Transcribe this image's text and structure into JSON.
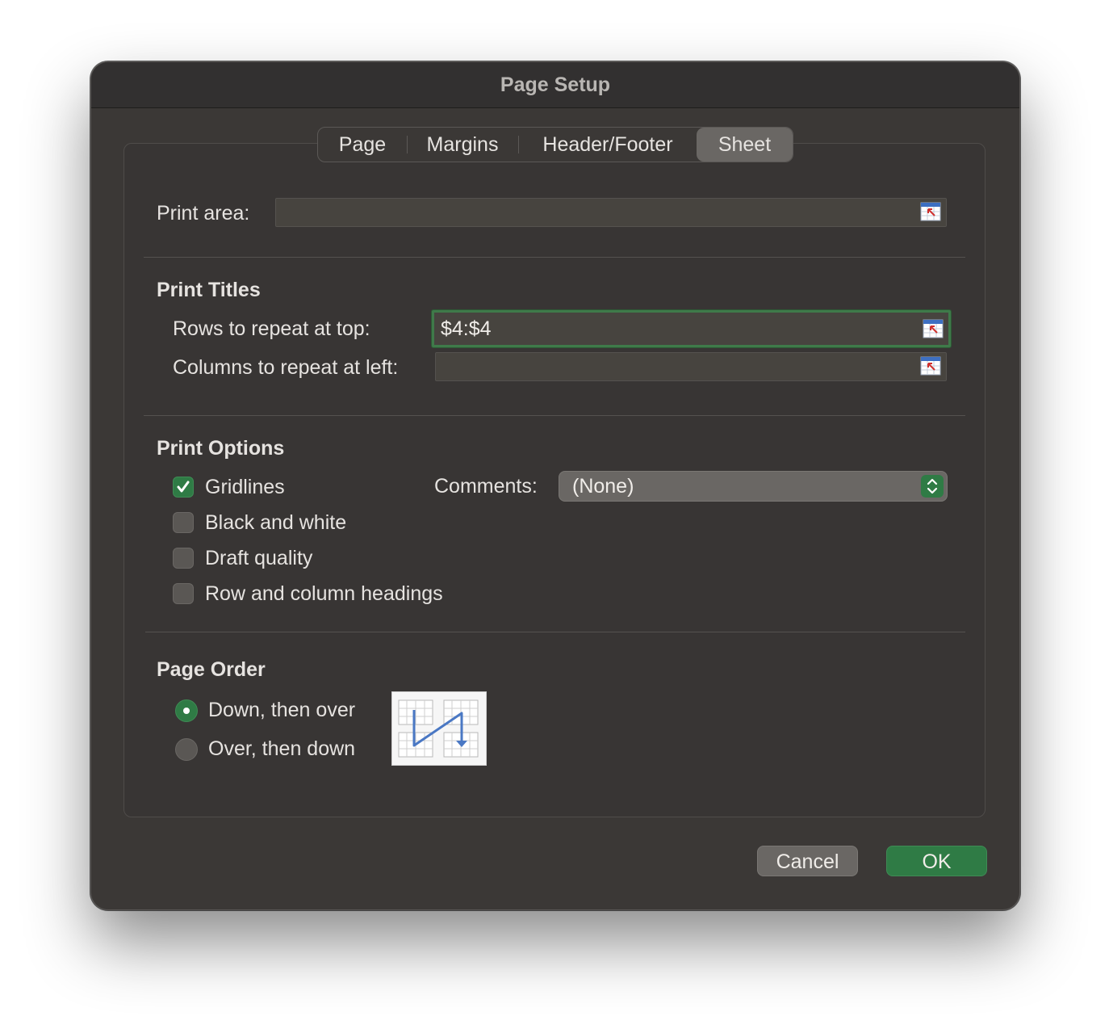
{
  "window": {
    "title": "Page Setup"
  },
  "tabs": [
    {
      "label": "Page",
      "active": false
    },
    {
      "label": "Margins",
      "active": false
    },
    {
      "label": "Header/Footer",
      "active": false
    },
    {
      "label": "Sheet",
      "active": true
    }
  ],
  "print_area": {
    "label": "Print area:",
    "value": "",
    "icon": "range-select-icon"
  },
  "print_titles": {
    "heading": "Print Titles",
    "rows_label": "Rows to repeat at top:",
    "rows_value": "$4:$4",
    "columns_label": "Columns to repeat at left:",
    "columns_value": ""
  },
  "print_options": {
    "heading": "Print Options",
    "gridlines": {
      "label": "Gridlines",
      "checked": true
    },
    "black_white": {
      "label": "Black and white",
      "checked": false
    },
    "draft": {
      "label": "Draft quality",
      "checked": false
    },
    "headings": {
      "label": "Row and column headings",
      "checked": false
    },
    "comments_label": "Comments:",
    "comments_value": "(None)"
  },
  "page_order": {
    "heading": "Page Order",
    "down_then_over": {
      "label": "Down, then over",
      "selected": true
    },
    "over_then_down": {
      "label": "Over, then down",
      "selected": false
    }
  },
  "buttons": {
    "cancel": "Cancel",
    "ok": "OK"
  },
  "colors": {
    "accent": "#2f7b45",
    "window_bg": "#3b3836",
    "focus_ring": "#3f7a4a"
  }
}
